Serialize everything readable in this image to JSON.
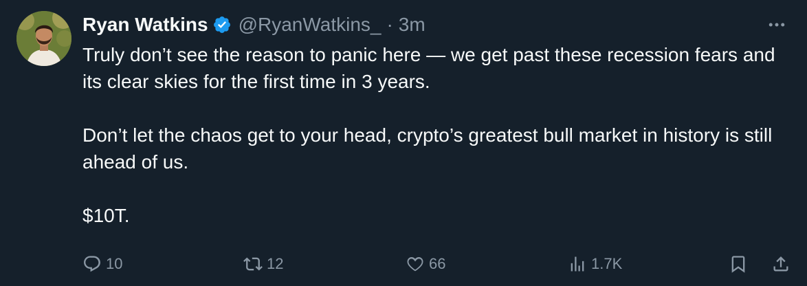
{
  "tweet": {
    "author": {
      "name": "Ryan Watkins",
      "handle": "@RyanWatkins_",
      "verified": true
    },
    "separator": "·",
    "time": "3m",
    "paragraphs": [
      "Truly don’t see the reason to panic here — we get past these recession fears and its clear skies for the first time in 3 years.",
      "Don’t let the chaos get to your head, crypto’s greatest bull market in history is still ahead of us.",
      "$10T."
    ],
    "stats": {
      "replies": "10",
      "retweets": "12",
      "likes": "66",
      "views": "1.7K"
    }
  },
  "icons": {
    "verified": "verified-badge-icon",
    "more": "more-horizontal-icon",
    "reply": "reply-icon",
    "retweet": "retweet-icon",
    "like": "heart-icon",
    "views": "views-bar-chart-icon",
    "bookmark": "bookmark-icon",
    "share": "share-icon"
  },
  "colors": {
    "background": "#15202b",
    "text": "#f7f9f9",
    "secondary": "#8b98a5",
    "verified": "#1d9bf0"
  }
}
